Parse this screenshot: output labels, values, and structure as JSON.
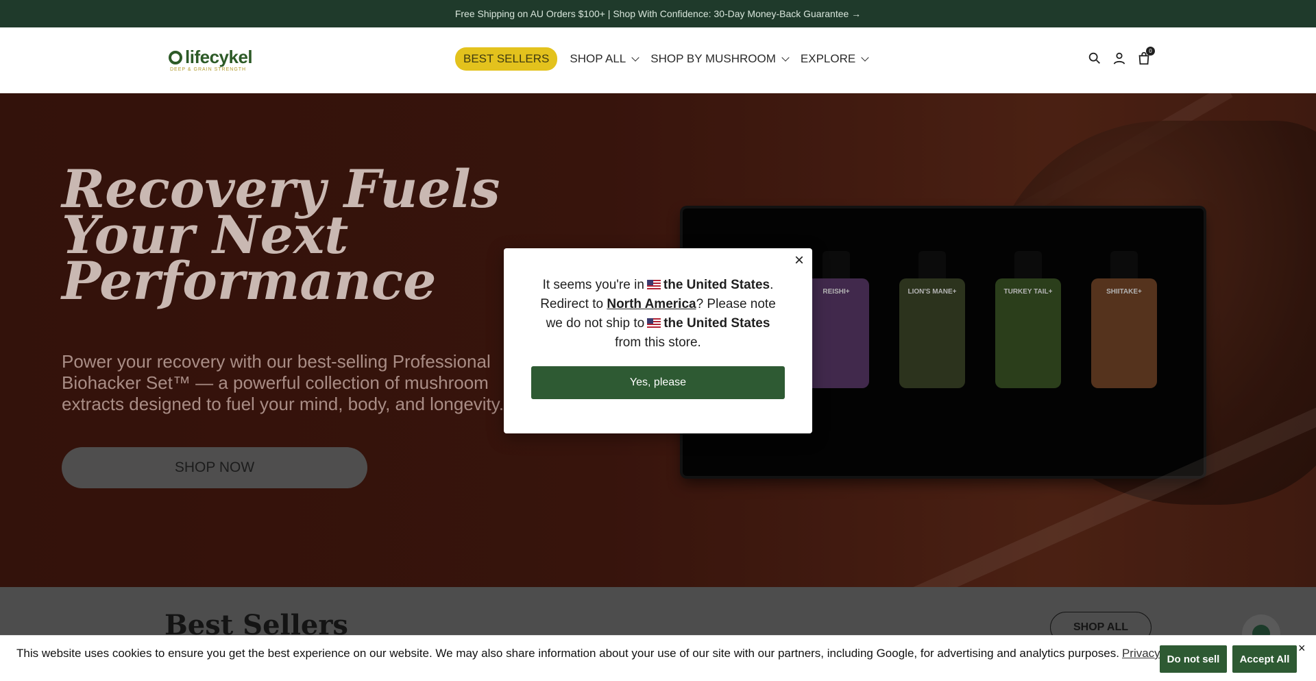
{
  "announcement": {
    "text": "Free Shipping on AU Orders $100+ | Shop With Confidence: 30-Day Money-Back Guarantee →"
  },
  "header": {
    "logo_text": "lifecykel",
    "logo_sub": "DEEP & GRAIN STRENGTH",
    "nav": [
      {
        "label": "BEST SELLERS"
      },
      {
        "label": "SHOP ALL"
      },
      {
        "label": "SHOP BY MUSHROOM"
      },
      {
        "label": "EXPLORE"
      }
    ],
    "icons": [
      "search-icon",
      "account-icon",
      "cart-icon"
    ],
    "cart_count": "0"
  },
  "hero": {
    "title": "Recovery Fuels Your Next Performance",
    "subtitle": "Power your recovery with our best-selling Professional Biohacker Set™ — a powerful collection of mushroom extracts designed to fuel your mind, body, and longevity.",
    "cta": "SHOP NOW",
    "bottles": [
      {
        "label": "REISHI+",
        "color": "#5e3b6e"
      },
      {
        "label": "LION'S MANE+",
        "color": "#3f4a2a"
      },
      {
        "label": "TURKEY TAIL+",
        "color": "#3e5a28"
      },
      {
        "label": "SHIITAKE+",
        "color": "#7a4a2a"
      }
    ]
  },
  "best_sellers": {
    "title": "Best Sellers",
    "shop_all": "SHOP ALL"
  },
  "modal": {
    "line1_prefix": "It seems you're in",
    "country": "the United States",
    "line1_suffix": ".",
    "redirect_prefix": "Redirect to",
    "redirect_target": "North America",
    "redirect_suffix": "? Please note we do not ship to",
    "country2": "the United States",
    "ship_suffix": "from this store.",
    "button": "Yes, please",
    "close": "×"
  },
  "cookie": {
    "text": "This website uses cookies to ensure you get the best experience on our website. We may also share information about your use of our site with our partners, including Google, for advertising and analytics purposes.",
    "link": "Privacy Policy",
    "do_not_sell": "Do not sell",
    "accept": "Accept All",
    "close": "×"
  },
  "colors": {
    "brand_green": "#2e5a33",
    "accent_yellow": "#e3c21d",
    "announce_bg": "#1f3a2b"
  }
}
